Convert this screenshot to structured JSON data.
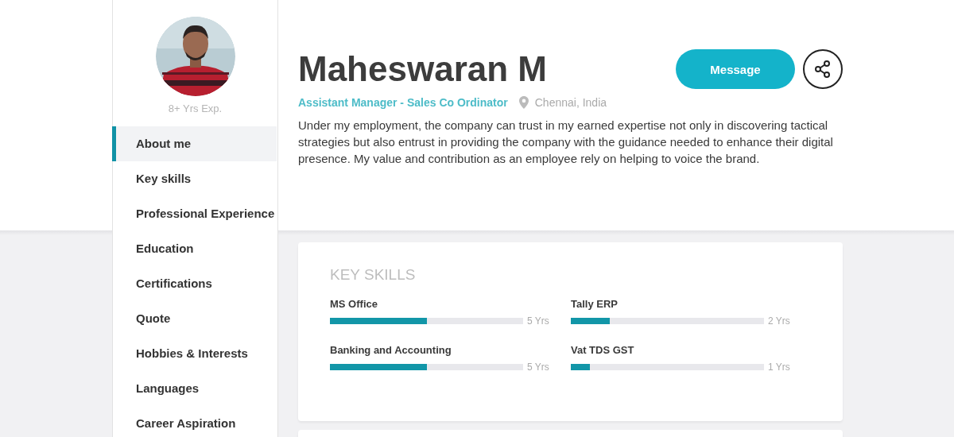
{
  "profile": {
    "experience": "8+ Yrs Exp.",
    "name": "Maheswaran M",
    "title": "Assistant Manager - Sales Co Ordinator",
    "location": "Chennai, India",
    "about": "Under my employment, the company can trust in my earned expertise not only in discovering tactical strategies but also entrust in providing the company with the guidance needed to enhance their digital presence. My value and contribution as an employee rely on helping to voice the brand.",
    "message_button": "Message"
  },
  "sidebar": {
    "items": [
      {
        "label": "About me",
        "selected": true
      },
      {
        "label": "Key skills",
        "selected": false
      },
      {
        "label": "Professional Experience",
        "selected": false
      },
      {
        "label": "Education",
        "selected": false
      },
      {
        "label": "Certifications",
        "selected": false
      },
      {
        "label": "Quote",
        "selected": false
      },
      {
        "label": "Hobbies & Interests",
        "selected": false
      },
      {
        "label": "Languages",
        "selected": false
      },
      {
        "label": "Career Aspiration",
        "selected": false
      }
    ]
  },
  "key_skills": {
    "heading": "KEY SKILLS",
    "skills": [
      {
        "name": "MS Office",
        "level": 0.5,
        "reading": "5 Yrs"
      },
      {
        "name": "Tally ERP",
        "level": 0.2,
        "reading": "2 Yrs"
      },
      {
        "name": "Banking and Accounting",
        "level": 0.5,
        "reading": "5 Yrs"
      },
      {
        "name": "Vat TDS GST",
        "level": 0.1,
        "reading": "1 Yrs"
      }
    ]
  }
}
